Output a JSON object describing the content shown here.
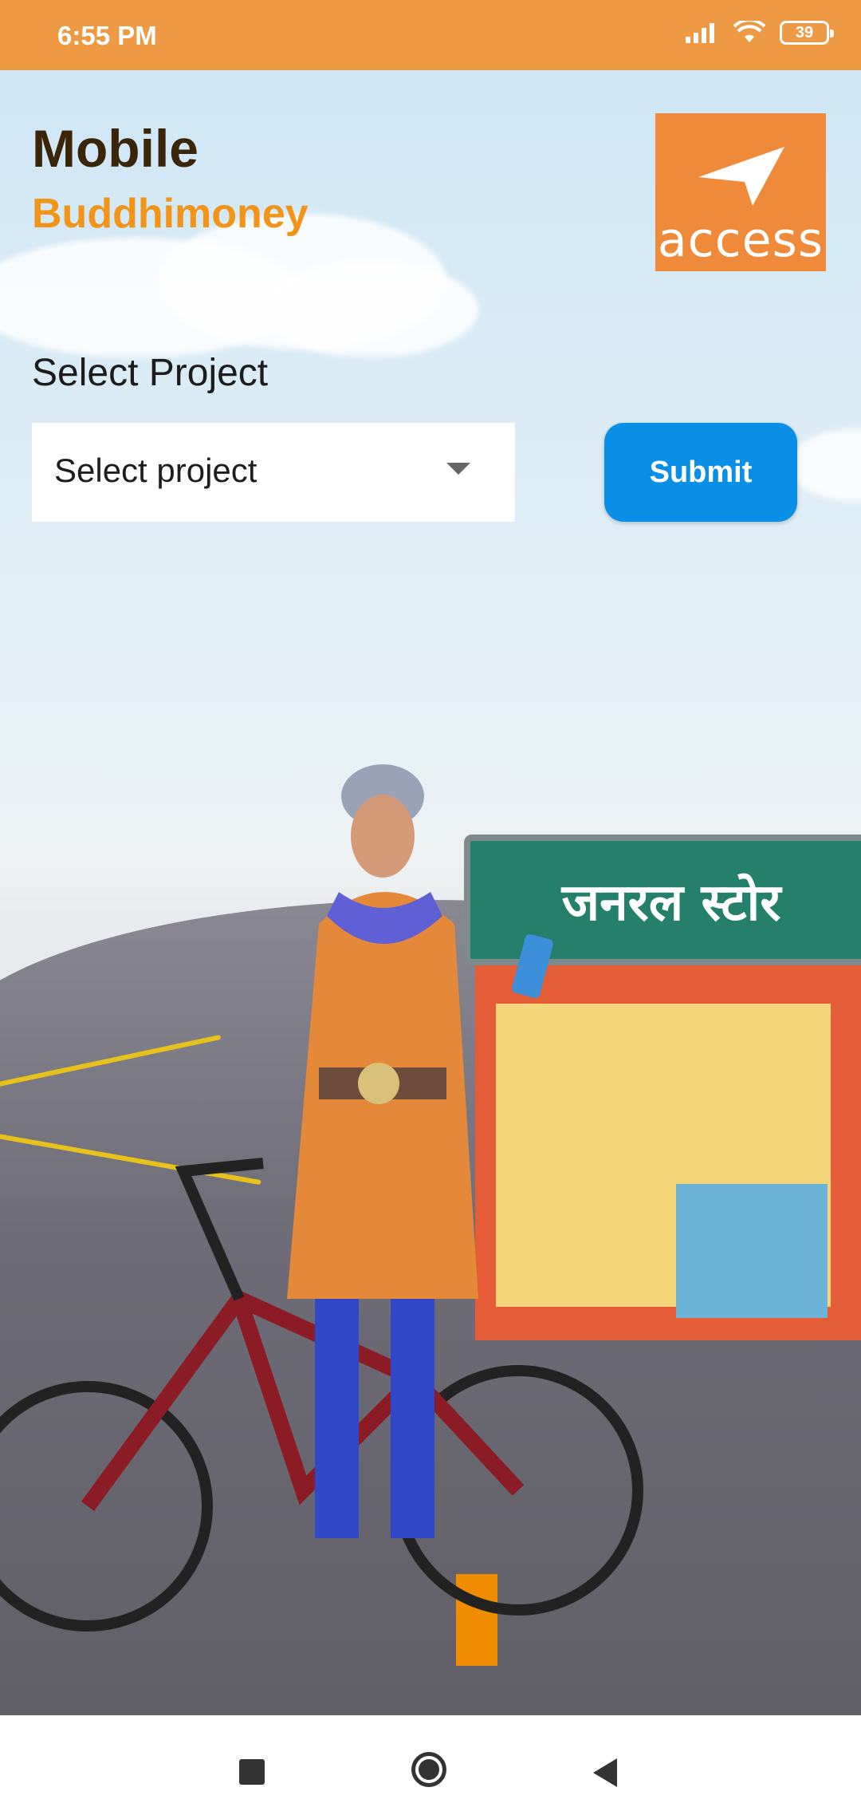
{
  "status_bar": {
    "time": "6:55 PM",
    "battery": "39"
  },
  "header": {
    "title_line1": "Mobile",
    "title_line2": "Buddhimoney"
  },
  "logo": {
    "text": "access"
  },
  "project": {
    "label": "Select Project",
    "dropdown_value": "Select project",
    "submit_label": "Submit"
  },
  "illustration": {
    "store_sign": "जनरल स्टोर"
  },
  "colors": {
    "status_bar": "#EE9A45",
    "brand_orange": "#F29418",
    "submit_blue": "#0A8FE6",
    "logo_bg": "#EE8A3A"
  }
}
